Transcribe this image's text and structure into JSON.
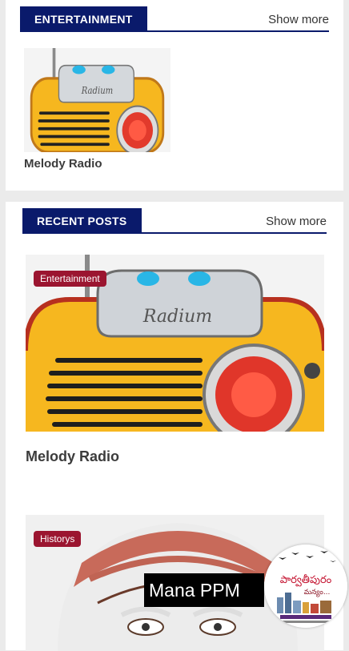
{
  "sections": [
    {
      "title": "ENTERTAINMENT",
      "show_more": "Show more",
      "posts": [
        {
          "title": "Melody Radio"
        }
      ]
    },
    {
      "title": "RECENT POSTS",
      "show_more": "Show more",
      "posts": [
        {
          "title": "Melody Radio",
          "category": "Entertainment"
        },
        {
          "title": "",
          "category": "Historys"
        }
      ]
    }
  ],
  "radio_brand": "Radium",
  "floating": {
    "promo_text": "Mana PPM",
    "logo_title": "పార్వతీపురం",
    "logo_subtitle": "మన్యం..."
  },
  "colors": {
    "section_navy": "#0a1a6b",
    "badge_red": "#9b1530",
    "radio_yellow": "#f6b71f"
  }
}
